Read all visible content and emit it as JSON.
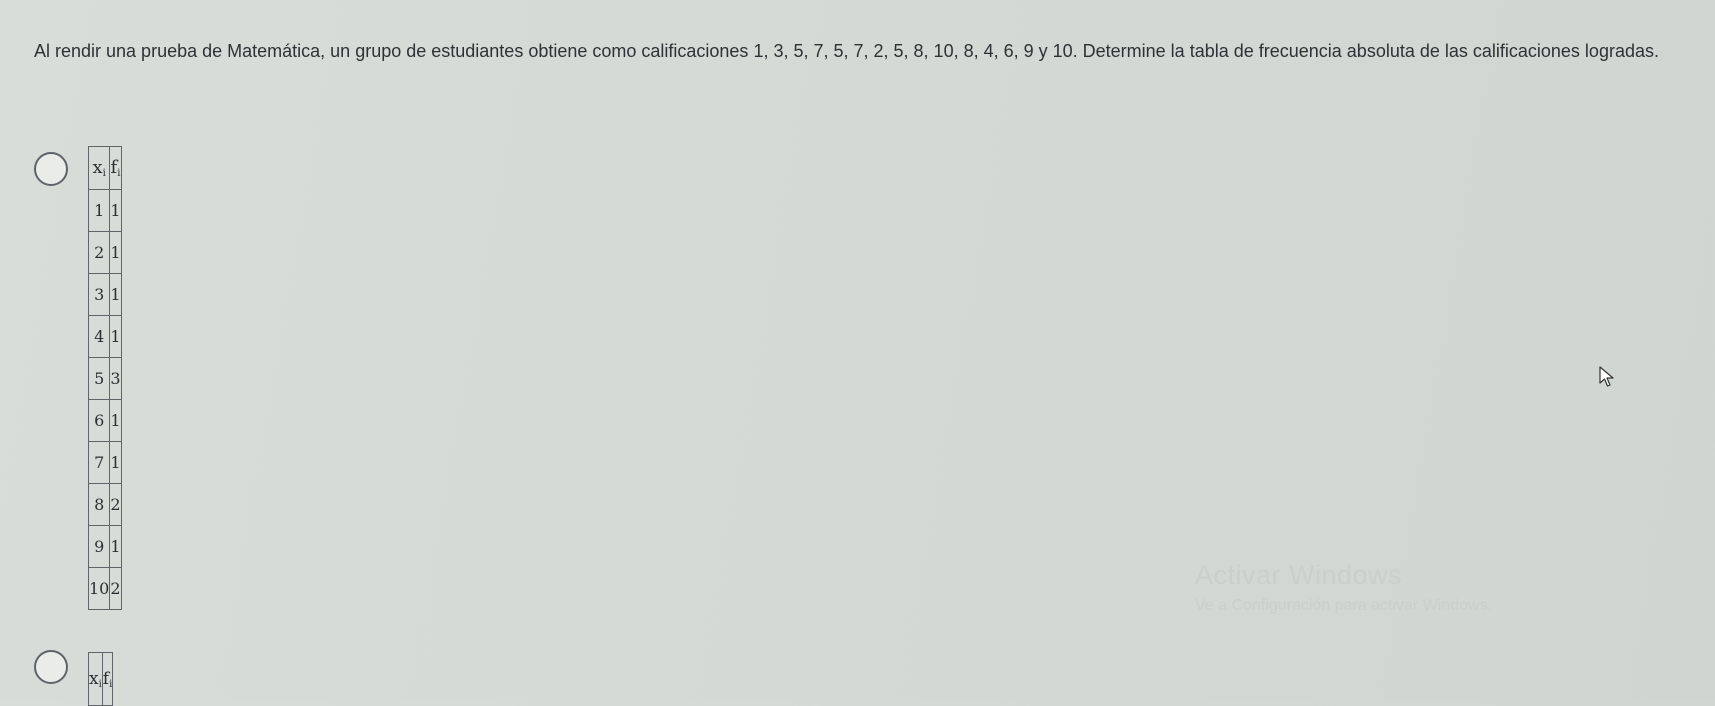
{
  "question": {
    "text": "Al rendir una prueba de Matemática, un grupo de estudiantes obtiene como calificaciones 1, 3, 5, 7, 5, 7, 2, 5, 8, 10, 8, 4, 6, 9 y 10. Determine la tabla de frecuencia absoluta de las calificaciones logradas."
  },
  "options": [
    {
      "header": {
        "x_symbol": "x",
        "x_sub": "i",
        "f_symbol": "f",
        "f_sub": "i"
      },
      "rows": [
        {
          "x": "1",
          "f": "1"
        },
        {
          "x": "2",
          "f": "1"
        },
        {
          "x": "3",
          "f": "1"
        },
        {
          "x": "4",
          "f": "1"
        },
        {
          "x": "5",
          "f": "3"
        },
        {
          "x": "6",
          "f": "1"
        },
        {
          "x": "7",
          "f": "1"
        },
        {
          "x": "8",
          "f": "2"
        },
        {
          "x": "9",
          "f": "1"
        },
        {
          "x": "10",
          "f": "2"
        }
      ]
    },
    {
      "header": {
        "x_symbol": "x",
        "x_sub": "i",
        "f_symbol": "f",
        "f_sub": "i"
      }
    }
  ],
  "watermark": {
    "title": "Activar Windows",
    "subtitle": "Ve a Configuración para activar Windows."
  },
  "icons": {
    "cursor": "mouse-pointer-icon",
    "radio": "radio-circle"
  }
}
